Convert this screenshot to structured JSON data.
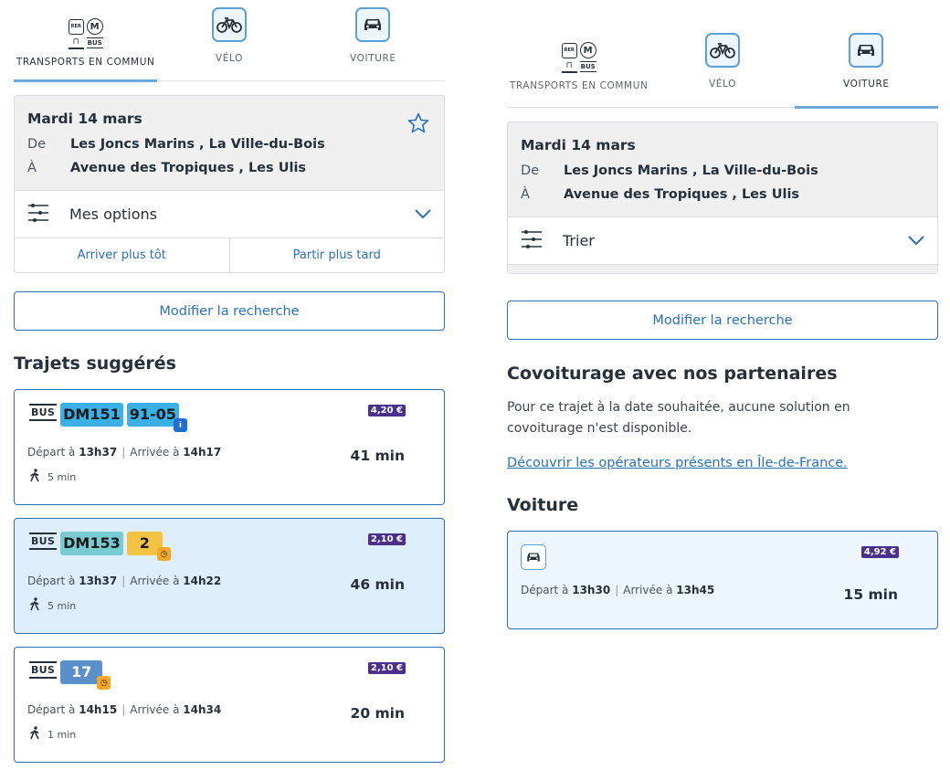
{
  "left": {
    "tabs": [
      {
        "label": "TRANSPORTS EN COMMUN",
        "icon": "transit-icon",
        "active": true
      },
      {
        "label": "VÉLO",
        "icon": "bike-icon",
        "active": false
      },
      {
        "label": "VOITURE",
        "icon": "car-icon",
        "active": false
      }
    ],
    "summary": {
      "date": "Mardi 14 mars",
      "from_label": "De",
      "from": "Les Joncs Marins , La Ville-du-Bois",
      "to_label": "À",
      "to": "Avenue des Tropiques , Les Ulis",
      "options_label": "Mes options",
      "earlier": "Arriver plus tôt",
      "later": "Partir plus tard"
    },
    "modify": "Modifier la recherche",
    "section_title": "Trajets suggérés",
    "journeys": [
      {
        "lines": [
          {
            "label": "DM151",
            "color": "#3ab0e6"
          },
          {
            "label": "91-05",
            "color": "#3ab0e6",
            "badge": "i"
          }
        ],
        "price": "4,20 €",
        "dep_label": "Départ à",
        "dep": "13h37",
        "arr_label": "Arrivée à",
        "arr": "14h17",
        "walk": "5 min",
        "duration": "41 min"
      },
      {
        "lines": [
          {
            "label": "DM153",
            "color": "#79cbd3"
          },
          {
            "label": "2",
            "color": "#f5c342",
            "badge": "clock"
          }
        ],
        "price": "2,10 €",
        "dep_label": "Départ à",
        "dep": "13h37",
        "arr_label": "Arrivée à",
        "arr": "14h22",
        "walk": "5 min",
        "duration": "46 min"
      },
      {
        "lines": [
          {
            "label": "17",
            "color": "#5b8fc9",
            "badge": "clock"
          }
        ],
        "price": "2,10 €",
        "dep_label": "Départ à",
        "dep": "14h15",
        "arr_label": "Arrivée à",
        "arr": "14h34",
        "walk": "1 min",
        "duration": "20 min"
      }
    ]
  },
  "right": {
    "tabs": [
      {
        "label": "TRANSPORTS EN COMMUN",
        "icon": "transit-icon",
        "active": false
      },
      {
        "label": "VÉLO",
        "icon": "bike-icon",
        "active": false
      },
      {
        "label": "VOITURE",
        "icon": "car-icon",
        "active": true
      }
    ],
    "summary": {
      "date": "Mardi 14 mars",
      "from_label": "De",
      "from": "Les Joncs Marins , La Ville-du-Bois",
      "to_label": "À",
      "to": "Avenue des Tropiques , Les Ulis",
      "options_label": "Trier"
    },
    "modify": "Modifier la recherche",
    "carpool_title": "Covoiturage avec nos partenaires",
    "carpool_text_1": "Pour ce trajet à la date souhaitée, aucune solution en",
    "carpool_text_2": "covoiturage n'est disponible.",
    "carpool_link": "Découvrir les opérateurs présents en Île-de-France.",
    "car_title": "Voiture",
    "car": {
      "price": "4,92 €",
      "dep_label": "Départ à",
      "dep": "13h30",
      "arr_label": "Arrivée à",
      "arr": "13h45",
      "duration": "15 min"
    }
  },
  "colors": {
    "accent": "#2b6fb9",
    "tab_underline": "#6ea7da",
    "price_bg": "#4b2f8d",
    "highlight": "#dfeefc"
  }
}
